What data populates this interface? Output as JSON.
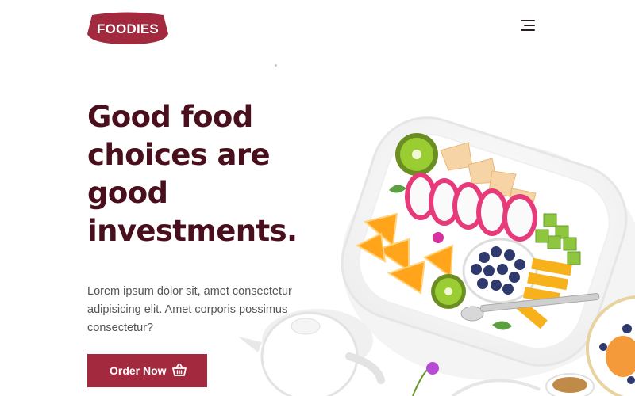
{
  "header": {
    "logo_text": "FOODIES",
    "menu_icon": "hamburger-menu-icon"
  },
  "hero": {
    "headline_lines": [
      "Good food",
      "choices are",
      "good",
      "investments."
    ],
    "description_lines": [
      "Lorem ipsum dolor sit, amet consectetur",
      "adipisicing elit. Amet corporis possimus",
      "consectetur?"
    ],
    "cta_label": "Order Now",
    "cta_icon": "basket-icon"
  },
  "image": {
    "subject": "fruit-plate-illustration"
  },
  "colors": {
    "brand": "#a3293f",
    "headline": "#4a0f1c",
    "body_text": "#555555"
  }
}
